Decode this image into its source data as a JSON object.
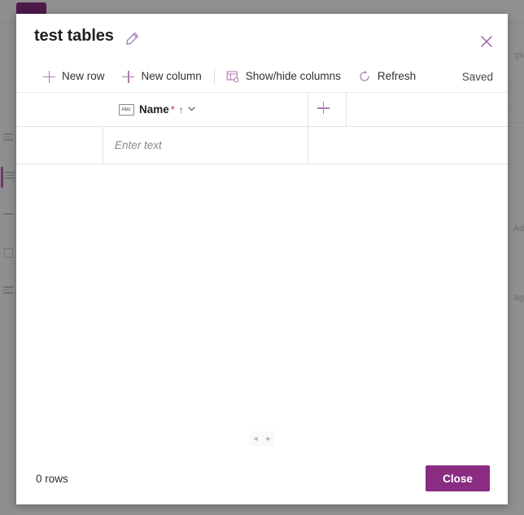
{
  "background": {
    "rail_items": [
      "menu-icon",
      "list-icon",
      "table-icon",
      "dash-icon",
      "doc-icon",
      "lines-icon"
    ],
    "right_fragments": [
      "gs",
      "Ad",
      "ag"
    ]
  },
  "dialog": {
    "title": "test tables",
    "edit_icon": "pencil-icon",
    "close_icon": "close-icon",
    "commands": [
      {
        "label": "New row",
        "icon": "plus-icon"
      },
      {
        "label": "New column",
        "icon": "plus-icon"
      },
      {
        "label": "Show/hide columns",
        "icon": "columns-icon"
      },
      {
        "label": "Refresh",
        "icon": "refresh-icon"
      }
    ],
    "status": "Saved",
    "grid": {
      "column": {
        "type_icon": "abc-icon",
        "type_label": "Abc",
        "name": "Name",
        "required_marker": "*",
        "sort_icon": "↑",
        "menu_icon": "⌄"
      },
      "add_column_icon": "plus-icon",
      "row_placeholder": "Enter text"
    },
    "pager": {
      "prev_icon": "◂",
      "next_icon": "▸"
    },
    "footer": {
      "rows_count": "0 rows",
      "close_label": "Close"
    }
  },
  "colors": {
    "accent": "#8a2c82",
    "accent_light": "#b07cb0",
    "tab_chip": "#4b1a4b",
    "required": "#c4314b"
  }
}
